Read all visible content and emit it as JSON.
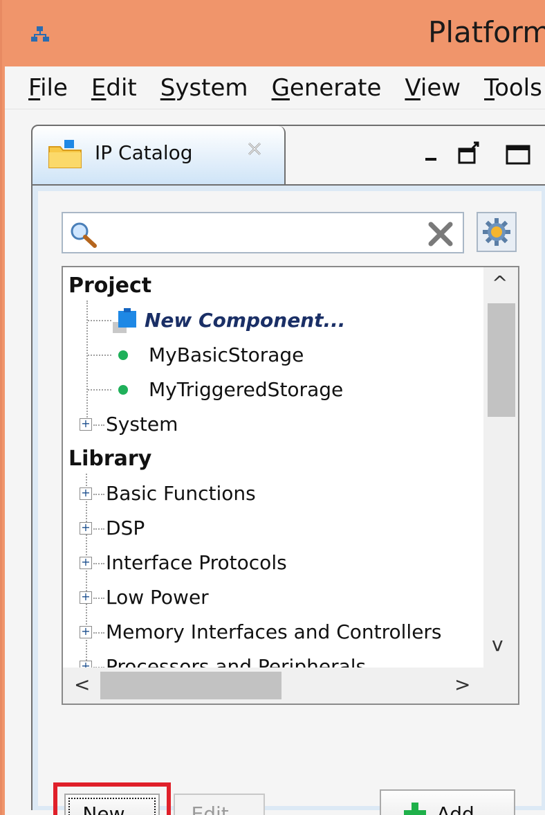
{
  "window": {
    "title": "Platform",
    "app_icon": "network-icon"
  },
  "menu": {
    "items": [
      {
        "label": "File",
        "mnemonic": "F",
        "rest": "ile"
      },
      {
        "label": "Edit",
        "mnemonic": "E",
        "rest": "dit"
      },
      {
        "label": "System",
        "mnemonic": "S",
        "rest": "ystem"
      },
      {
        "label": "Generate",
        "mnemonic": "G",
        "rest": "enerate"
      },
      {
        "label": "View",
        "mnemonic": "V",
        "rest": "iew"
      },
      {
        "label": "Tools",
        "mnemonic": "T",
        "rest": "ools"
      }
    ]
  },
  "panel": {
    "tab_label": "IP Catalog",
    "tab_icon": "folder-icon",
    "close_icon": "close-tab-icon",
    "minimize_icon": "minimize-icon",
    "detach_icon": "detach-icon",
    "maximize_icon": "maximize-icon"
  },
  "search": {
    "value": "",
    "placeholder": "",
    "search_icon": "magnifier-icon",
    "clear_icon": "clear-x-icon",
    "settings_icon": "gear-icon"
  },
  "tree": {
    "project_heading": "Project",
    "project_items": [
      {
        "label": "New Component...",
        "icon": "new-component-icon",
        "style": "italic-bold"
      },
      {
        "label": "MyBasicStorage",
        "icon": "green-dot-icon"
      },
      {
        "label": "MyTriggeredStorage",
        "icon": "green-dot-icon"
      },
      {
        "label": "System",
        "icon": "expand-icon"
      }
    ],
    "library_heading": "Library",
    "library_items": [
      {
        "label": "Basic Functions"
      },
      {
        "label": "DSP"
      },
      {
        "label": "Interface Protocols"
      },
      {
        "label": "Low Power"
      },
      {
        "label": "Memory Interfaces and Controllers"
      },
      {
        "label": "Processors and Peripherals"
      }
    ]
  },
  "buttons": {
    "new": "New...",
    "edit": "Edit...",
    "add": "Add...",
    "add_icon": "green-plus-icon"
  },
  "colors": {
    "title_bar": "#f0956b",
    "highlight": "#e0202a",
    "status_dot": "#1fb05a"
  }
}
